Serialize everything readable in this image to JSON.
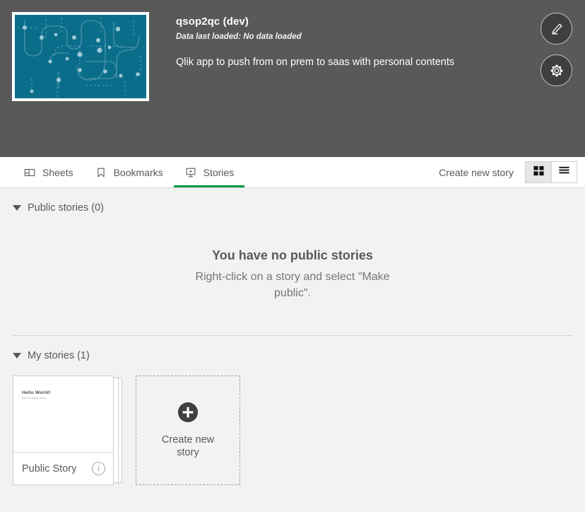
{
  "colors": {
    "header_bg": "#595959",
    "content_bg": "#f2f2f2",
    "accent_green": "#009845",
    "thumbnail_teal": "#0a6e8a",
    "text_dark": "#595959"
  },
  "app_header": {
    "title": "qsop2qc (dev)",
    "last_loaded": "Data last loaded: No data loaded",
    "description": "Qlik app to push from on prem to saas with personal contents",
    "thumbnail_name": "app-thumbnail",
    "actions": [
      {
        "name": "edit-app-button",
        "icon": "pencil-icon",
        "label": "Edit"
      },
      {
        "name": "app-settings-button",
        "icon": "gear-icon",
        "label": "App options"
      }
    ]
  },
  "tabbar": {
    "tabs": [
      {
        "label": "Sheets",
        "icon": "sheet-icon",
        "active": false
      },
      {
        "label": "Bookmarks",
        "icon": "bookmark-icon",
        "active": false
      },
      {
        "label": "Stories",
        "icon": "story-icon",
        "active": true
      }
    ],
    "create_link": "Create new story",
    "view_modes": [
      {
        "name": "grid-view-toggle",
        "icon": "grid-icon",
        "selected": true
      },
      {
        "name": "list-view-toggle",
        "icon": "list-icon",
        "selected": false
      }
    ]
  },
  "public_section": {
    "title": "Public stories (0)",
    "empty_title": "You have no public stories",
    "empty_subtitle": "Right-click on a story and select \"Make public\"."
  },
  "my_section": {
    "title": "My stories (1)",
    "stories": [
      {
        "name": "Public Story",
        "preview_title": "Hello World!",
        "preview_subtitle": "this is a public story",
        "info_glyph": "i"
      }
    ],
    "create_tile": {
      "label": "Create new story",
      "icon": "plus-icon"
    }
  }
}
